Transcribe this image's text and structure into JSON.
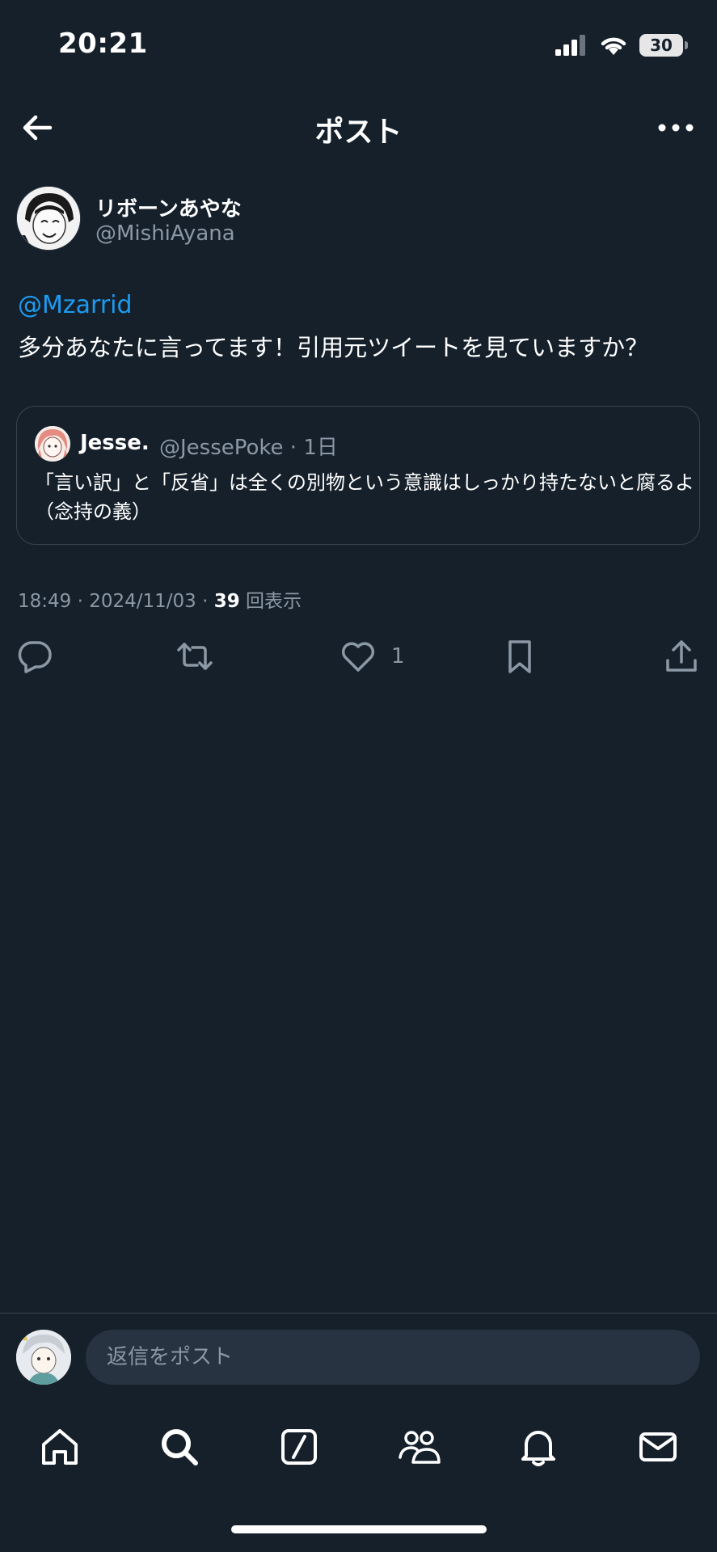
{
  "status_bar": {
    "time": "20:21",
    "battery": "30"
  },
  "header": {
    "title": "ポスト"
  },
  "post": {
    "author_name": "リボーンあやな",
    "author_handle": "@MishiAyana",
    "mention": "@Mzarrid",
    "text": "多分あなたに言ってます！引用元ツイートを見ていますか？",
    "quote": {
      "name": "Jesse.",
      "meta": "@JessePoke · 1日",
      "text": "「言い訳」と「反省」は全くの別物という意識はしっかり持たないと腐るよ（念持の義）"
    },
    "time": "18:49 · 2024/11/03 · ",
    "views": "39",
    "views_label": " 回表示",
    "like_count": "1"
  },
  "reply": {
    "placeholder": "返信をポスト"
  },
  "colors": {
    "background": "#15202b",
    "accent": "#1d9bf0",
    "secondary_text": "#8b98a5",
    "border": "#38444d"
  },
  "icons": {
    "back": "arrow-left-icon",
    "more": "more-horizontal-icon",
    "reply": "reply-bubble-icon",
    "retweet": "retweet-icon",
    "like": "heart-icon",
    "bookmark": "bookmark-icon",
    "share": "share-icon",
    "tabs": [
      "home-icon",
      "search-icon",
      "grok-icon",
      "communities-icon",
      "notifications-icon",
      "messages-icon"
    ]
  }
}
